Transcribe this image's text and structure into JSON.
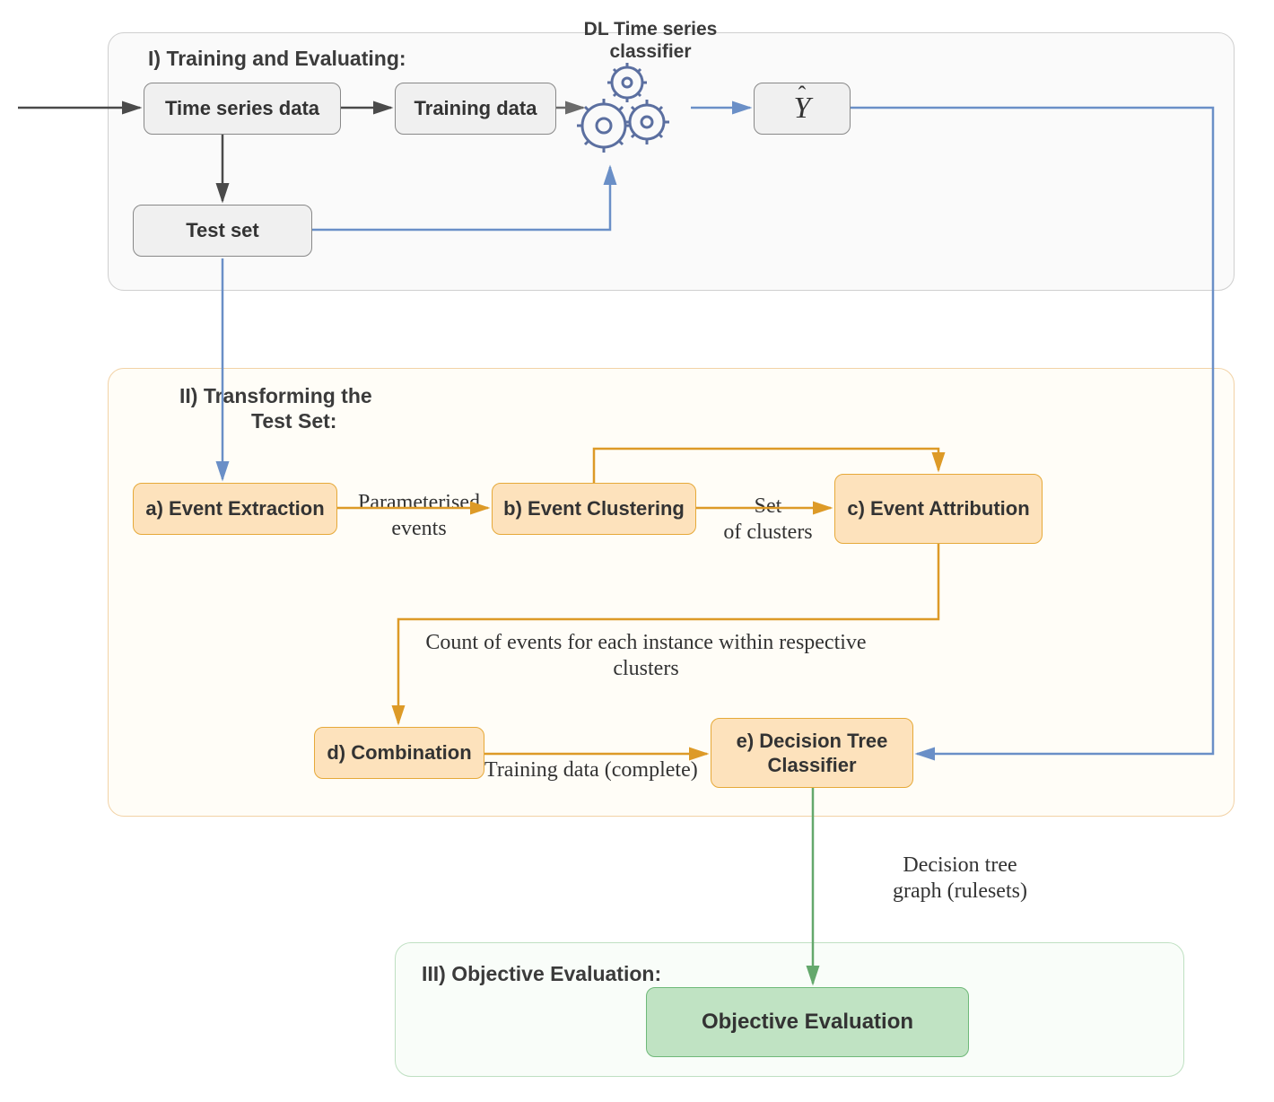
{
  "sections": {
    "s1_title": "I) Training and Evaluating:",
    "s2_title_l1": "II) Transforming the",
    "s2_title_l2": "Test Set:",
    "s3_title": "III) Objective Evaluation:"
  },
  "nodes": {
    "time_series": "Time series data",
    "training_data": "Training data",
    "test_set": "Test set",
    "yhat_main": "Y",
    "yhat_hat": "ˆ",
    "classifier_label_l1": "DL Time series",
    "classifier_label_l2": "classifier",
    "event_extraction": "a)  Event Extraction",
    "event_clustering": "b)  Event Clustering",
    "event_attribution": "c)  Event Attribution",
    "combination": "d)  Combination",
    "decision_tree_l1": "e)  Decision Tree",
    "decision_tree_l2": "Classifier",
    "objective_eval": "Objective Evaluation"
  },
  "edges": {
    "param_events_l1": "Parameterised",
    "param_events_l2": "events",
    "set_clusters_l1": "Set",
    "set_clusters_l2": "of clusters",
    "count_events_l1": "Count of events for each instance within respective",
    "count_events_l2": "clusters",
    "training_complete": "Training data (complete)",
    "decision_tree_graph_l1": "Decision tree",
    "decision_tree_graph_l2": "graph (rulesets)"
  },
  "colors": {
    "gray_arrow": "#4a4a4a",
    "blue_arrow": "#6a8fc7",
    "orange_arrow": "#dd9a27",
    "green_arrow": "#64a86c",
    "gear_stroke": "#5b6fa0"
  }
}
